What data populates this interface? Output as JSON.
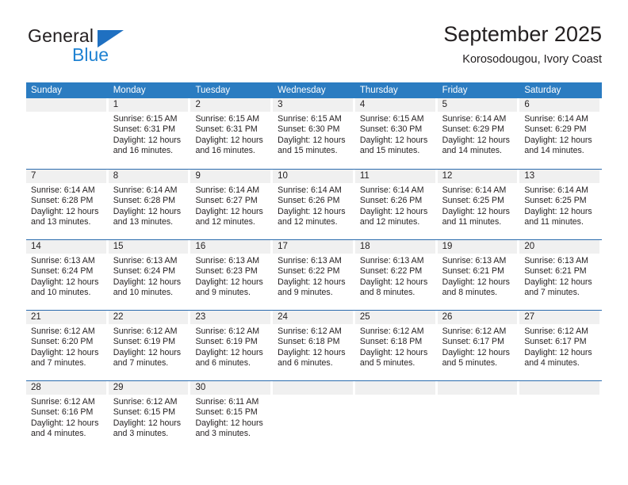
{
  "brand": {
    "name_top": "General",
    "name_bottom": "Blue",
    "triangle_color": "#1f70c1",
    "blue_text_color": "#1f82d2"
  },
  "header": {
    "month_title": "September 2025",
    "location": "Korosodougou, Ivory Coast"
  },
  "colors": {
    "header_blue": "#2b7cc1",
    "row_divider_blue": "#2b6cae",
    "day_band_gray": "#f0f0f0",
    "text": "#231f20"
  },
  "weekdays": [
    "Sunday",
    "Monday",
    "Tuesday",
    "Wednesday",
    "Thursday",
    "Friday",
    "Saturday"
  ],
  "weeks": [
    [
      {
        "day": "",
        "sunrise": "",
        "sunset": "",
        "daylight_line1": "",
        "daylight_line2": ""
      },
      {
        "day": "1",
        "sunrise": "Sunrise: 6:15 AM",
        "sunset": "Sunset: 6:31 PM",
        "daylight_line1": "Daylight: 12 hours",
        "daylight_line2": "and 16 minutes."
      },
      {
        "day": "2",
        "sunrise": "Sunrise: 6:15 AM",
        "sunset": "Sunset: 6:31 PM",
        "daylight_line1": "Daylight: 12 hours",
        "daylight_line2": "and 16 minutes."
      },
      {
        "day": "3",
        "sunrise": "Sunrise: 6:15 AM",
        "sunset": "Sunset: 6:30 PM",
        "daylight_line1": "Daylight: 12 hours",
        "daylight_line2": "and 15 minutes."
      },
      {
        "day": "4",
        "sunrise": "Sunrise: 6:15 AM",
        "sunset": "Sunset: 6:30 PM",
        "daylight_line1": "Daylight: 12 hours",
        "daylight_line2": "and 15 minutes."
      },
      {
        "day": "5",
        "sunrise": "Sunrise: 6:14 AM",
        "sunset": "Sunset: 6:29 PM",
        "daylight_line1": "Daylight: 12 hours",
        "daylight_line2": "and 14 minutes."
      },
      {
        "day": "6",
        "sunrise": "Sunrise: 6:14 AM",
        "sunset": "Sunset: 6:29 PM",
        "daylight_line1": "Daylight: 12 hours",
        "daylight_line2": "and 14 minutes."
      }
    ],
    [
      {
        "day": "7",
        "sunrise": "Sunrise: 6:14 AM",
        "sunset": "Sunset: 6:28 PM",
        "daylight_line1": "Daylight: 12 hours",
        "daylight_line2": "and 13 minutes."
      },
      {
        "day": "8",
        "sunrise": "Sunrise: 6:14 AM",
        "sunset": "Sunset: 6:28 PM",
        "daylight_line1": "Daylight: 12 hours",
        "daylight_line2": "and 13 minutes."
      },
      {
        "day": "9",
        "sunrise": "Sunrise: 6:14 AM",
        "sunset": "Sunset: 6:27 PM",
        "daylight_line1": "Daylight: 12 hours",
        "daylight_line2": "and 12 minutes."
      },
      {
        "day": "10",
        "sunrise": "Sunrise: 6:14 AM",
        "sunset": "Sunset: 6:26 PM",
        "daylight_line1": "Daylight: 12 hours",
        "daylight_line2": "and 12 minutes."
      },
      {
        "day": "11",
        "sunrise": "Sunrise: 6:14 AM",
        "sunset": "Sunset: 6:26 PM",
        "daylight_line1": "Daylight: 12 hours",
        "daylight_line2": "and 12 minutes."
      },
      {
        "day": "12",
        "sunrise": "Sunrise: 6:14 AM",
        "sunset": "Sunset: 6:25 PM",
        "daylight_line1": "Daylight: 12 hours",
        "daylight_line2": "and 11 minutes."
      },
      {
        "day": "13",
        "sunrise": "Sunrise: 6:14 AM",
        "sunset": "Sunset: 6:25 PM",
        "daylight_line1": "Daylight: 12 hours",
        "daylight_line2": "and 11 minutes."
      }
    ],
    [
      {
        "day": "14",
        "sunrise": "Sunrise: 6:13 AM",
        "sunset": "Sunset: 6:24 PM",
        "daylight_line1": "Daylight: 12 hours",
        "daylight_line2": "and 10 minutes."
      },
      {
        "day": "15",
        "sunrise": "Sunrise: 6:13 AM",
        "sunset": "Sunset: 6:24 PM",
        "daylight_line1": "Daylight: 12 hours",
        "daylight_line2": "and 10 minutes."
      },
      {
        "day": "16",
        "sunrise": "Sunrise: 6:13 AM",
        "sunset": "Sunset: 6:23 PM",
        "daylight_line1": "Daylight: 12 hours",
        "daylight_line2": "and 9 minutes."
      },
      {
        "day": "17",
        "sunrise": "Sunrise: 6:13 AM",
        "sunset": "Sunset: 6:22 PM",
        "daylight_line1": "Daylight: 12 hours",
        "daylight_line2": "and 9 minutes."
      },
      {
        "day": "18",
        "sunrise": "Sunrise: 6:13 AM",
        "sunset": "Sunset: 6:22 PM",
        "daylight_line1": "Daylight: 12 hours",
        "daylight_line2": "and 8 minutes."
      },
      {
        "day": "19",
        "sunrise": "Sunrise: 6:13 AM",
        "sunset": "Sunset: 6:21 PM",
        "daylight_line1": "Daylight: 12 hours",
        "daylight_line2": "and 8 minutes."
      },
      {
        "day": "20",
        "sunrise": "Sunrise: 6:13 AM",
        "sunset": "Sunset: 6:21 PM",
        "daylight_line1": "Daylight: 12 hours",
        "daylight_line2": "and 7 minutes."
      }
    ],
    [
      {
        "day": "21",
        "sunrise": "Sunrise: 6:12 AM",
        "sunset": "Sunset: 6:20 PM",
        "daylight_line1": "Daylight: 12 hours",
        "daylight_line2": "and 7 minutes."
      },
      {
        "day": "22",
        "sunrise": "Sunrise: 6:12 AM",
        "sunset": "Sunset: 6:19 PM",
        "daylight_line1": "Daylight: 12 hours",
        "daylight_line2": "and 7 minutes."
      },
      {
        "day": "23",
        "sunrise": "Sunrise: 6:12 AM",
        "sunset": "Sunset: 6:19 PM",
        "daylight_line1": "Daylight: 12 hours",
        "daylight_line2": "and 6 minutes."
      },
      {
        "day": "24",
        "sunrise": "Sunrise: 6:12 AM",
        "sunset": "Sunset: 6:18 PM",
        "daylight_line1": "Daylight: 12 hours",
        "daylight_line2": "and 6 minutes."
      },
      {
        "day": "25",
        "sunrise": "Sunrise: 6:12 AM",
        "sunset": "Sunset: 6:18 PM",
        "daylight_line1": "Daylight: 12 hours",
        "daylight_line2": "and 5 minutes."
      },
      {
        "day": "26",
        "sunrise": "Sunrise: 6:12 AM",
        "sunset": "Sunset: 6:17 PM",
        "daylight_line1": "Daylight: 12 hours",
        "daylight_line2": "and 5 minutes."
      },
      {
        "day": "27",
        "sunrise": "Sunrise: 6:12 AM",
        "sunset": "Sunset: 6:17 PM",
        "daylight_line1": "Daylight: 12 hours",
        "daylight_line2": "and 4 minutes."
      }
    ],
    [
      {
        "day": "28",
        "sunrise": "Sunrise: 6:12 AM",
        "sunset": "Sunset: 6:16 PM",
        "daylight_line1": "Daylight: 12 hours",
        "daylight_line2": "and 4 minutes."
      },
      {
        "day": "29",
        "sunrise": "Sunrise: 6:12 AM",
        "sunset": "Sunset: 6:15 PM",
        "daylight_line1": "Daylight: 12 hours",
        "daylight_line2": "and 3 minutes."
      },
      {
        "day": "30",
        "sunrise": "Sunrise: 6:11 AM",
        "sunset": "Sunset: 6:15 PM",
        "daylight_line1": "Daylight: 12 hours",
        "daylight_line2": "and 3 minutes."
      },
      {
        "day": "",
        "sunrise": "",
        "sunset": "",
        "daylight_line1": "",
        "daylight_line2": ""
      },
      {
        "day": "",
        "sunrise": "",
        "sunset": "",
        "daylight_line1": "",
        "daylight_line2": ""
      },
      {
        "day": "",
        "sunrise": "",
        "sunset": "",
        "daylight_line1": "",
        "daylight_line2": ""
      },
      {
        "day": "",
        "sunrise": "",
        "sunset": "",
        "daylight_line1": "",
        "daylight_line2": ""
      }
    ]
  ]
}
